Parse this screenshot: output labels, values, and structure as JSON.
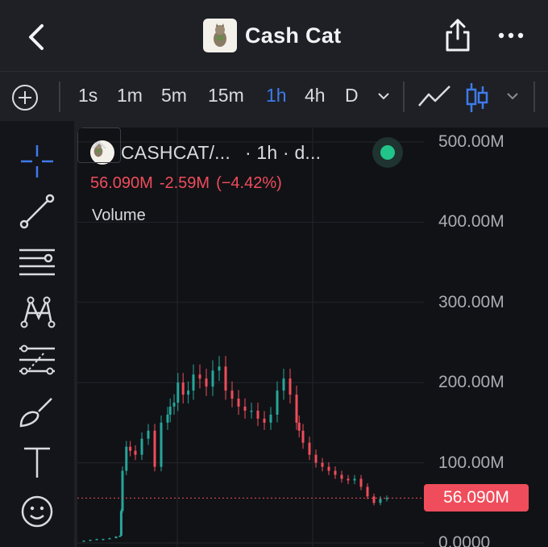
{
  "header": {
    "title": "Cash Cat"
  },
  "toolbar": {
    "timeframes": [
      "1s",
      "1m",
      "5m",
      "15m",
      "1h",
      "4h",
      "D"
    ],
    "active_timeframe": "1h"
  },
  "chart": {
    "symbol_label": "CASHCAT/...",
    "interval_label": "· 1h · d...",
    "last_price": "56.090M",
    "change": "-2.59M",
    "change_pct": "(−4.42%)",
    "volume_label": "Volume",
    "price_tag": "56.090M",
    "status_color": "#22c489",
    "down_color": "#ef4d5b",
    "up_color": "#26a69a",
    "accent_color": "#3f7bea"
  },
  "chart_data": {
    "type": "line",
    "yticks": [
      "500.00M",
      "400.00M",
      "300.00M",
      "200.00M",
      "100.00M",
      "0.0000"
    ],
    "ylim": [
      0,
      500
    ],
    "yunit": "M",
    "x": [
      0,
      5,
      10,
      15,
      20,
      25,
      30,
      33,
      34,
      35,
      38,
      41,
      45,
      50,
      55,
      60,
      65,
      70,
      72,
      75,
      78,
      82,
      86,
      90,
      95,
      100,
      105,
      110,
      115,
      120,
      125,
      130,
      135,
      140,
      145,
      150,
      155,
      160,
      165,
      170,
      172,
      175,
      180,
      185,
      190,
      195,
      200,
      205,
      210,
      215,
      220,
      225,
      230,
      235,
      240
    ],
    "values": [
      2,
      3,
      4,
      5,
      5,
      6,
      8,
      9,
      40,
      90,
      120,
      115,
      110,
      130,
      140,
      95,
      150,
      160,
      170,
      175,
      200,
      185,
      190,
      210,
      205,
      195,
      215,
      220,
      190,
      180,
      170,
      165,
      165,
      155,
      150,
      160,
      190,
      205,
      185,
      150,
      140,
      125,
      110,
      100,
      95,
      90,
      85,
      80,
      78,
      80,
      70,
      58,
      50,
      55,
      56
    ]
  }
}
